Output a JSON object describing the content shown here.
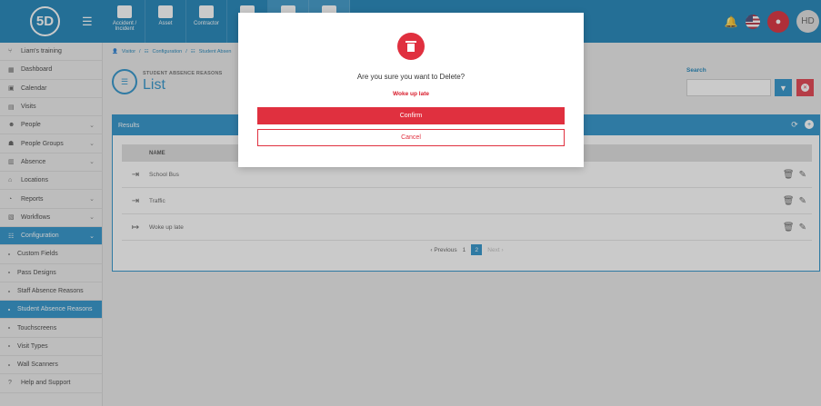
{
  "app": {
    "logo_text": "5D"
  },
  "topnav": [
    {
      "label": "Accident / Incident",
      "icon": "first-aid-icon"
    },
    {
      "label": "Asset",
      "icon": "boxes-icon"
    },
    {
      "label": "Contractor",
      "icon": "hard-hat-icon"
    },
    {
      "label": "",
      "icon": "document-icon"
    },
    {
      "label": "",
      "icon": "user-icon"
    },
    {
      "label": "",
      "icon": "database-icon"
    }
  ],
  "user": {
    "initials": "HD"
  },
  "sidebar": {
    "items": [
      {
        "label": "Liam's training",
        "icon": "branch-icon",
        "type": "main",
        "chevron": false
      },
      {
        "label": "Dashboard",
        "icon": "dashboard-icon",
        "type": "main",
        "chevron": false
      },
      {
        "label": "Calendar",
        "icon": "calendar-icon",
        "type": "main",
        "chevron": false
      },
      {
        "label": "Visits",
        "icon": "visits-icon",
        "type": "main",
        "chevron": false
      },
      {
        "label": "People",
        "icon": "people-icon",
        "type": "main",
        "chevron": true
      },
      {
        "label": "People Groups",
        "icon": "people-groups-icon",
        "type": "main",
        "chevron": true
      },
      {
        "label": "Absence",
        "icon": "absence-icon",
        "type": "main",
        "chevron": true
      },
      {
        "label": "Locations",
        "icon": "locations-icon",
        "type": "main",
        "chevron": false
      },
      {
        "label": "Reports",
        "icon": "reports-icon",
        "type": "main",
        "chevron": true
      },
      {
        "label": "Workflows",
        "icon": "workflows-icon",
        "type": "main",
        "chevron": true
      },
      {
        "label": "Configuration",
        "icon": "configuration-icon",
        "type": "main",
        "chevron": true,
        "active": true
      },
      {
        "label": "Custom Fields",
        "type": "sub"
      },
      {
        "label": "Pass Designs",
        "type": "sub"
      },
      {
        "label": "Staff Absence Reasons",
        "type": "sub"
      },
      {
        "label": "Student Absence Reasons",
        "type": "sub",
        "active": true
      },
      {
        "label": "Touchscreens",
        "type": "sub"
      },
      {
        "label": "Visit Types",
        "type": "sub"
      },
      {
        "label": "Wall Scanners",
        "type": "sub"
      },
      {
        "label": "Help and Support",
        "icon": "help-icon",
        "type": "main",
        "chevron": false
      }
    ]
  },
  "breadcrumb": {
    "home": "Visitor",
    "section": "Configuration",
    "page": "Student Absen"
  },
  "page": {
    "subtitle": "STUDENT ABSENCE REASONS",
    "title": "List"
  },
  "search": {
    "label": "Search",
    "placeholder": ""
  },
  "results": {
    "title": "Results",
    "column_name": "NAME",
    "rows": [
      {
        "name": "School Bus",
        "icon": "sign-in-icon"
      },
      {
        "name": "Traffic",
        "icon": "sign-in-icon"
      },
      {
        "name": "Woke up late",
        "icon": "sign-out-icon"
      }
    ],
    "pager": {
      "previous": "Previous",
      "pages": [
        "1",
        "2"
      ],
      "current": "2",
      "next": "Next"
    }
  },
  "modal": {
    "question": "Are you sure you want to Delete?",
    "item_name": "Woke up late",
    "confirm_label": "Confirm",
    "cancel_label": "Cancel"
  },
  "colors": {
    "brand": "#0b79b3",
    "accent": "#1b8ac6",
    "danger": "#e0303f"
  }
}
